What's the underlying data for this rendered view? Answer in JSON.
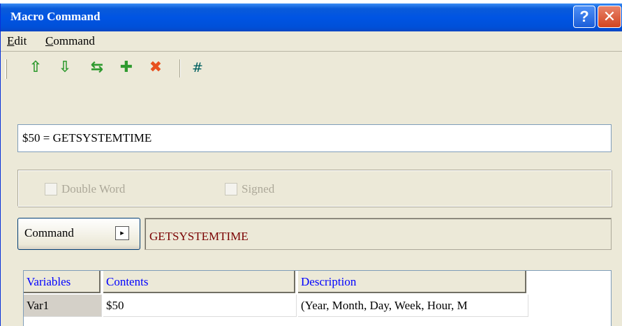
{
  "window": {
    "title": "Macro Command",
    "help_glyph": "?",
    "close_glyph": "✕"
  },
  "menu": {
    "edit": {
      "mnemonic": "E",
      "rest": "dit"
    },
    "command": {
      "mnemonic": "C",
      "rest": "ommand"
    }
  },
  "toolbar": {
    "move_up_glyph": "⇧",
    "move_down_glyph": "⇩",
    "swap_glyph": "⇆",
    "add_glyph": "✚",
    "delete_glyph": "✖",
    "hash_label": "#",
    "colors": {
      "green": "#2f9a2f",
      "red": "#e8501e",
      "hash": "#006060"
    }
  },
  "expression": {
    "value": "$50 = GETSYSTEMTIME"
  },
  "options": {
    "double_word": {
      "label": "Double Word",
      "checked": false,
      "enabled": false
    },
    "signed": {
      "label": "Signed",
      "checked": false,
      "enabled": false
    }
  },
  "command": {
    "button_label": "Command",
    "arrow_glyph": "▸",
    "selected": "GETSYSTEMTIME"
  },
  "grid": {
    "headers": [
      "Variables",
      "Contents",
      "Description"
    ],
    "rows": [
      [
        "Var1",
        "$50",
        "(Year, Month, Day, Week, Hour, M"
      ]
    ]
  }
}
